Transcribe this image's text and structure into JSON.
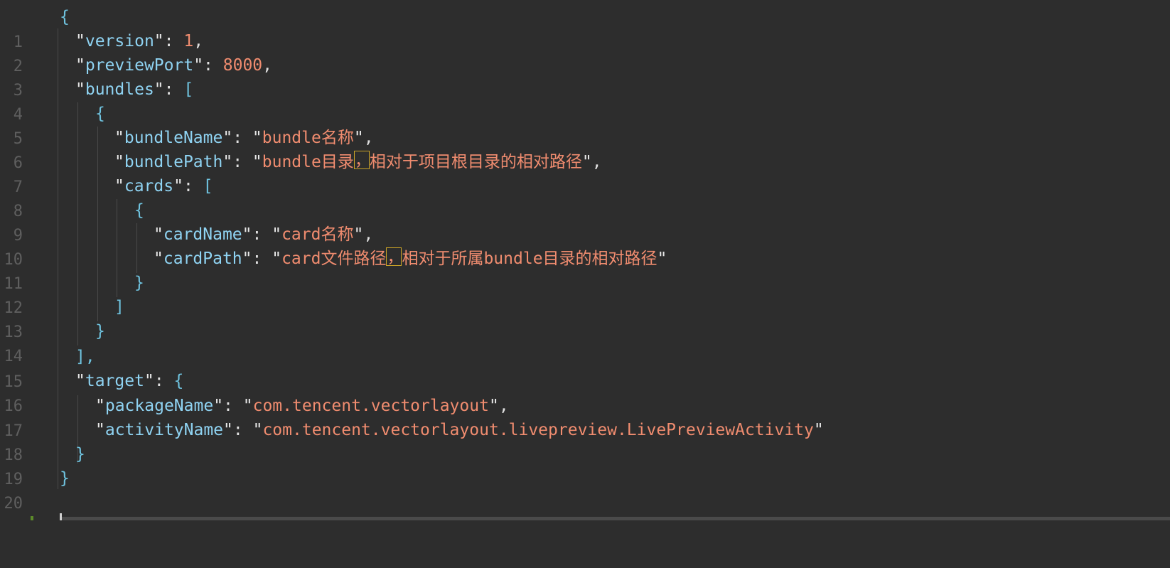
{
  "editor": {
    "language": "json",
    "colors": {
      "background": "#2d2d2d",
      "line_number": "#5f5f5f",
      "brace": "#6fc3df",
      "key": "#8fd3f2",
      "string_value": "#f08c6f",
      "number": "#f08c6f",
      "highlight_border": "#c9a227",
      "change_marker": "#5c8a2a"
    },
    "line_numbers": [
      "1",
      "2",
      "3",
      "4",
      "5",
      "6",
      "7",
      "8",
      "9",
      "10",
      "11",
      "12",
      "13",
      "14",
      "15",
      "16",
      "17",
      "18",
      "19",
      "20"
    ],
    "lines": [
      {
        "brace": "{"
      },
      {
        "key": "version",
        "sep": ": ",
        "num": "1",
        "trail": ","
      },
      {
        "key": "previewPort",
        "sep": ": ",
        "num": "8000",
        "trail": ","
      },
      {
        "key": "bundles",
        "sep": ": ",
        "open": "["
      },
      {
        "brace": "{"
      },
      {
        "key": "bundleName",
        "sep": ": ",
        "value": "bundle名称",
        "trail": ","
      },
      {
        "key": "bundlePath",
        "sep": ": ",
        "value_a": "bundle目录",
        "value_comma": "，",
        "value_b": "相对于项目根目录的相对路径",
        "trail": ","
      },
      {
        "key": "cards",
        "sep": ": ",
        "open": "["
      },
      {
        "brace": "{"
      },
      {
        "key": "cardName",
        "sep": ": ",
        "value": "card名称",
        "trail": ","
      },
      {
        "key": "cardPath",
        "sep": ": ",
        "value_a": "card文件路径",
        "value_comma": "，",
        "value_b": "相对于所属bundle目录的相对路径",
        "trail": ""
      },
      {
        "brace": "}"
      },
      {
        "brace": "]"
      },
      {
        "brace": "}"
      },
      {
        "brace": "],"
      },
      {
        "key": "target",
        "sep": ": ",
        "open": "{"
      },
      {
        "key": "packageName",
        "sep": ": ",
        "value": "com.tencent.vectorlayout",
        "trail": ","
      },
      {
        "key": "activityName",
        "sep": ": ",
        "value": "com.tencent.vectorlayout.livepreview.LivePreviewActivity",
        "trail": ""
      },
      {
        "brace": "}"
      },
      {
        "brace": "}"
      }
    ]
  }
}
